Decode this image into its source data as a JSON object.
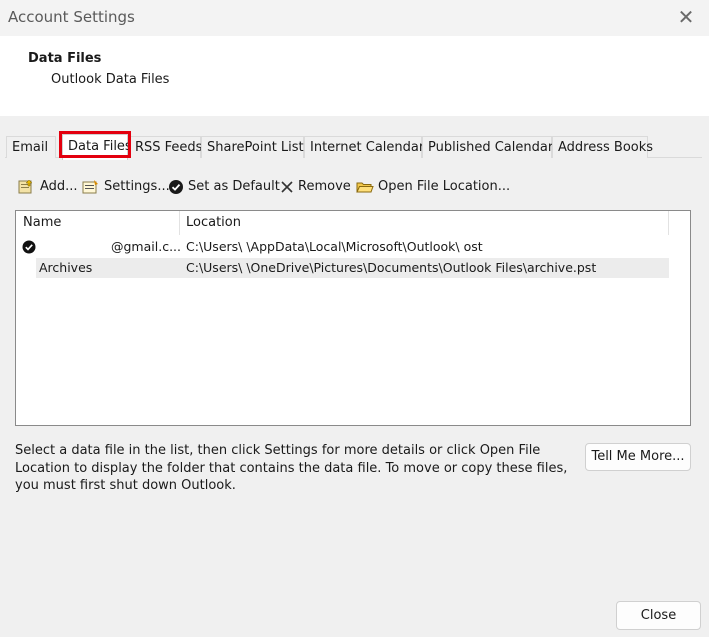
{
  "window": {
    "title": "Account Settings",
    "close_glyph": "✕"
  },
  "header": {
    "title": "Data Files",
    "subtitle": "Outlook Data Files"
  },
  "tabs": [
    {
      "label": "Email"
    },
    {
      "label": "Data Files",
      "active": true
    },
    {
      "label": "RSS Feeds"
    },
    {
      "label": "SharePoint Lists"
    },
    {
      "label": "Internet Calendars"
    },
    {
      "label": "Published Calendars"
    },
    {
      "label": "Address Books"
    }
  ],
  "toolbar": {
    "add_label": "Add...",
    "settings_label": "Settings...",
    "set_default_label": "Set as Default",
    "remove_label": "Remove",
    "open_location_label": "Open File Location..."
  },
  "list": {
    "columns": [
      "Name",
      "Location"
    ],
    "rows": [
      {
        "name": "@gmail.c...",
        "location": "C:\\Users\\      \\AppData\\Local\\Microsoft\\Outlook\\                                        ost",
        "default": true
      },
      {
        "name": "Archives",
        "location": "C:\\Users\\         \\OneDrive\\Pictures\\Documents\\Outlook Files\\archive.pst",
        "default": false
      }
    ]
  },
  "description": "Select a data file in the list, then click Settings for more details or click Open File Location to display the folder that contains the data file. To move or copy these files, you must first shut down Outlook.",
  "buttons": {
    "tell_me_more": "Tell Me More...",
    "close": "Close"
  },
  "colors": {
    "highlight": "#e3000f",
    "background": "#f0f0f0"
  }
}
